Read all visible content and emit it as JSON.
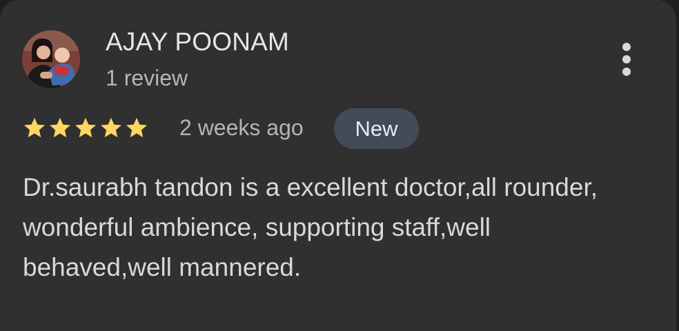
{
  "review": {
    "author_name": "AJAY POONAM",
    "review_count": "1 review",
    "rating": 5,
    "rating_max": 5,
    "time_ago": "2 weeks ago",
    "badge": "New",
    "text": "Dr.saurabh tandon is a excellent doctor,all rounder, wonderful ambience, supporting staff,well behaved,well mannered."
  },
  "icons": {
    "more": "more-vert-icon",
    "star": "star-icon"
  },
  "colors": {
    "card_background": "#303030",
    "star": "#fdd663",
    "badge_background": "#434a58"
  }
}
